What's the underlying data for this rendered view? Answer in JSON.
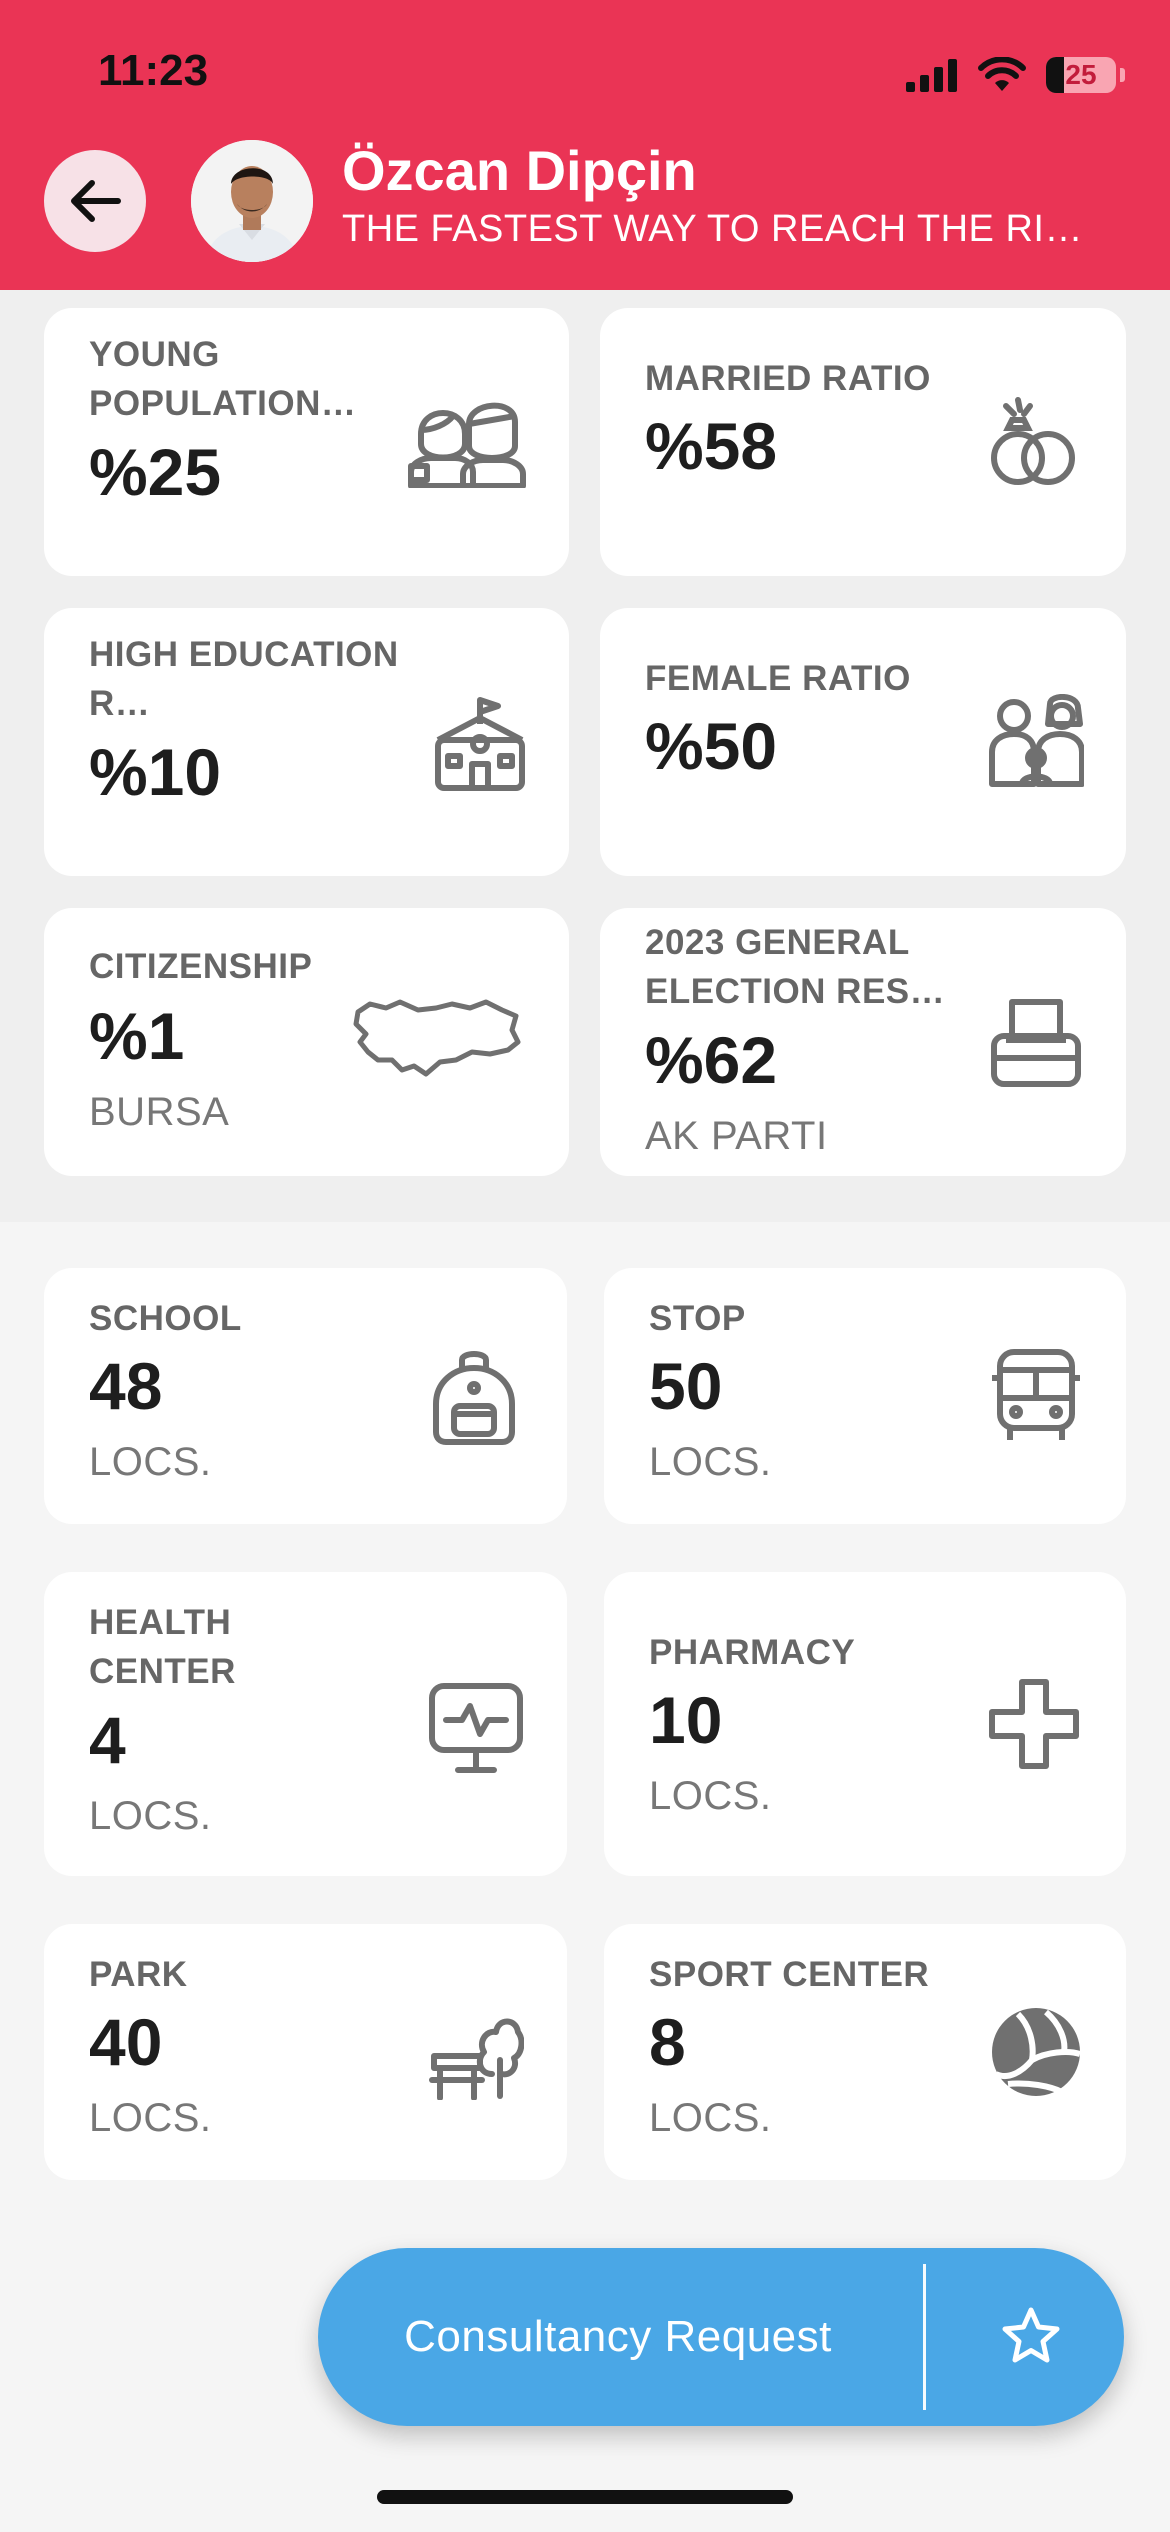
{
  "status_bar": {
    "time": "11:23",
    "battery": "25"
  },
  "header": {
    "name": "Özcan Dipçin",
    "subtitle": "THE FASTEST WAY TO REACH THE RIGHT INFORMATION"
  },
  "stats": [
    {
      "label": "YOUNG POPULATION…",
      "value": "%25",
      "sub": "",
      "icon": "young-people-icon"
    },
    {
      "label": "MARRIED RATIO",
      "value": "%58",
      "sub": "",
      "icon": "rings-icon"
    },
    {
      "label": "HIGH EDUCATION R…",
      "value": "%10",
      "sub": "",
      "icon": "school-building-icon"
    },
    {
      "label": "FEMALE RATIO",
      "value": "%50",
      "sub": "",
      "icon": "family-icon"
    },
    {
      "label": "CITIZENSHIP",
      "value": "%1",
      "sub": "BURSA",
      "icon": "turkey-map-icon"
    },
    {
      "label": "2023 GENERAL ELECTION RES…",
      "value": "%62",
      "sub": "AK PARTI",
      "icon": "ballot-box-icon"
    }
  ],
  "places": [
    {
      "label": "SCHOOL",
      "value": "48",
      "sub": "LOCS.",
      "icon": "backpack-icon"
    },
    {
      "label": "STOP",
      "value": "50",
      "sub": "LOCS.",
      "icon": "bus-icon"
    },
    {
      "label": "HEALTH CENTER",
      "value": "4",
      "sub": "LOCS.",
      "icon": "health-monitor-icon"
    },
    {
      "label": "PHARMACY",
      "value": "10",
      "sub": "LOCS.",
      "icon": "medical-cross-icon"
    },
    {
      "label": "PARK",
      "value": "40",
      "sub": "LOCS.",
      "icon": "park-bench-icon"
    },
    {
      "label": "SPORT CENTER",
      "value": "8",
      "sub": "LOCS.",
      "icon": "volleyball-icon"
    }
  ],
  "cta": {
    "label": "Consultancy Request"
  },
  "colors": {
    "header": "#ea3455",
    "cta": "#4aa7e6",
    "icon": "#707070"
  }
}
